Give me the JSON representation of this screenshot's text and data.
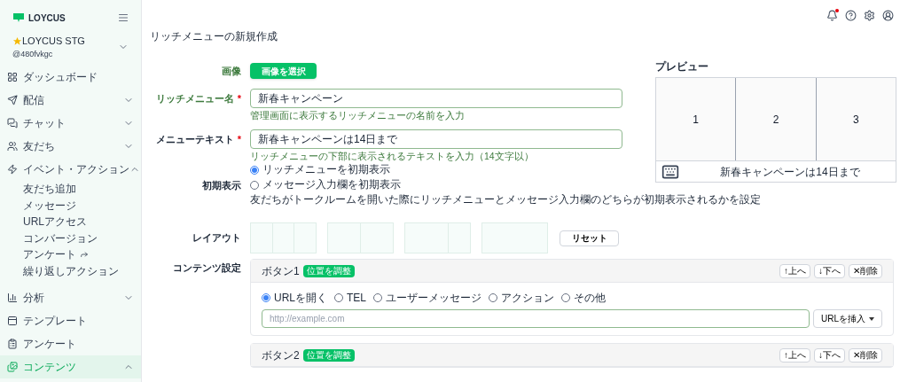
{
  "brand": {
    "name": "LOYCUS"
  },
  "account": {
    "name": "LOYCUS STG",
    "id": "@480fvkgc"
  },
  "sidebar": {
    "items": [
      {
        "label": "ダッシュボード",
        "selected": false
      },
      {
        "label": "配信",
        "selected": false,
        "expanded": false
      },
      {
        "label": "チャット",
        "selected": false,
        "expanded": false
      },
      {
        "label": "友だち",
        "selected": false,
        "expanded": false
      },
      {
        "label": "イベント・アクション",
        "selected": false,
        "expanded": true,
        "children": [
          {
            "label": "友だち追加"
          },
          {
            "label": "メッセージ"
          },
          {
            "label": "URLアクセス"
          },
          {
            "label": "コンバージョン"
          },
          {
            "label": "アンケート",
            "external": true
          },
          {
            "label": "繰り返しアクション"
          }
        ]
      },
      {
        "label": "分析",
        "selected": false,
        "expanded": false
      },
      {
        "label": "テンプレート",
        "selected": false
      },
      {
        "label": "アンケート",
        "selected": false
      },
      {
        "label": "コンテンツ",
        "selected": true,
        "expanded": true
      }
    ]
  },
  "header": {
    "notification_unread": true
  },
  "page_title": "リッチメニューの新規作成",
  "form": {
    "image": {
      "label": "画像",
      "button": "画像を選択"
    },
    "name": {
      "label": "リッチメニュー名",
      "required_mark": "*",
      "value": "新春キャンペーン",
      "help": "管理画面に表示するリッチメニューの名前を入力"
    },
    "menu_text": {
      "label": "メニューテキスト",
      "required_mark": "*",
      "value": "新春キャンペーンは14日まで",
      "help": "リッチメニューの下部に表示されるテキストを入力（14文字以）"
    },
    "initial_display": {
      "label": "初期表示",
      "options": [
        {
          "label": "リッチメニューを初期表示",
          "selected": true
        },
        {
          "label": "メッセージ入力欄を初期表示",
          "selected": false
        }
      ],
      "help": "友だちがトークルームを開いた際にリッチメニューとメッセージ入力欄のどちらが初期表示されるかを設定"
    },
    "layout": {
      "label": "レイアウト",
      "reset": "リセット"
    },
    "contents": {
      "label": "コンテンツ設定",
      "buttons": [
        {
          "title": "ボタン1",
          "badge": "位置を調整",
          "up": "↑上へ",
          "down": "↓下へ",
          "delete": "✕削除",
          "actions": [
            {
              "label": "URLを開く",
              "selected": true
            },
            {
              "label": "TEL",
              "selected": false
            },
            {
              "label": "ユーザーメッセージ",
              "selected": false
            },
            {
              "label": "アクション",
              "selected": false
            },
            {
              "label": "その他",
              "selected": false
            }
          ],
          "placeholder": "http://example.com",
          "insert": "URLを挿入"
        },
        {
          "title": "ボタン2",
          "badge": "位置を調整",
          "up": "↑上へ",
          "down": "↓下へ",
          "delete": "✕削除"
        }
      ]
    }
  },
  "preview": {
    "title": "プレビュー",
    "cells": [
      "1",
      "2",
      "3"
    ],
    "menu_text": "新春キャンペーンは14日まで"
  }
}
